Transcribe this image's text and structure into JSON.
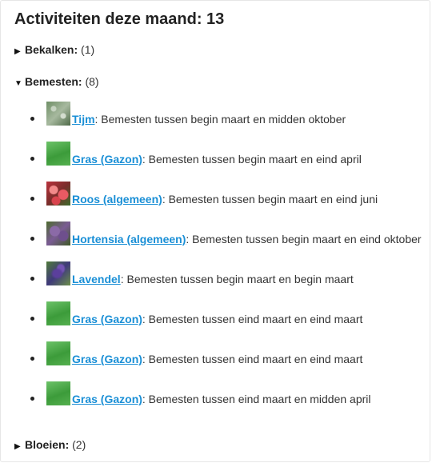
{
  "title": "Activiteiten deze maand: 13",
  "sections": [
    {
      "name": "Bekalken:",
      "count": "(1)",
      "expanded": false,
      "arrow": "▶"
    },
    {
      "name": "Bemesten:",
      "count": "(8)",
      "expanded": true,
      "arrow": "▼"
    },
    {
      "name": "Bloeien:",
      "count": "(2)",
      "expanded": false,
      "arrow": "▶"
    }
  ],
  "bemesten_items": [
    {
      "plant": "Tijm",
      "text": ": Bemesten tussen begin maart en midden oktober",
      "thumb": "thyme"
    },
    {
      "plant": "Gras (Gazon)",
      "text": ": Bemesten tussen begin maart en eind april",
      "thumb": "grass"
    },
    {
      "plant": "Roos (algemeen)",
      "text": ": Bemesten tussen begin maart en eind juni",
      "thumb": "rose"
    },
    {
      "plant": "Hortensia (algemeen)",
      "text": ": Bemesten tussen begin maart en eind oktober",
      "thumb": "hortensia"
    },
    {
      "plant": "Lavendel",
      "text": ": Bemesten tussen begin maart en begin maart",
      "thumb": "lavendel"
    },
    {
      "plant": "Gras (Gazon)",
      "text": ": Bemesten tussen eind maart en eind maart",
      "thumb": "grass"
    },
    {
      "plant": "Gras (Gazon)",
      "text": ": Bemesten tussen eind maart en eind maart",
      "thumb": "grass"
    },
    {
      "plant": "Gras (Gazon)",
      "text": ": Bemesten tussen eind maart en midden april",
      "thumb": "grass"
    }
  ],
  "colors": {
    "link": "#1a8fd6",
    "text": "#333333"
  }
}
